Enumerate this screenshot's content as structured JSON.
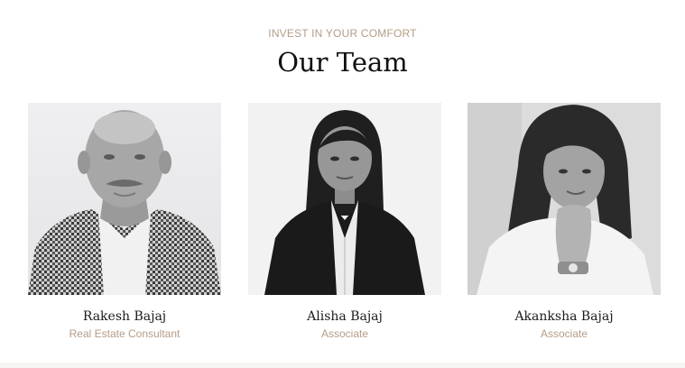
{
  "section": {
    "eyebrow": "INVEST IN YOUR COMFORT",
    "title": "Our Team"
  },
  "team": [
    {
      "name": "Rakesh Bajaj",
      "role": "Real Estate Consultant"
    },
    {
      "name": "Alisha Bajaj",
      "role": "Associate"
    },
    {
      "name": "Akanksha Bajaj",
      "role": "Associate"
    }
  ],
  "colors": {
    "accent": "#b59c86",
    "heading": "#111111"
  }
}
